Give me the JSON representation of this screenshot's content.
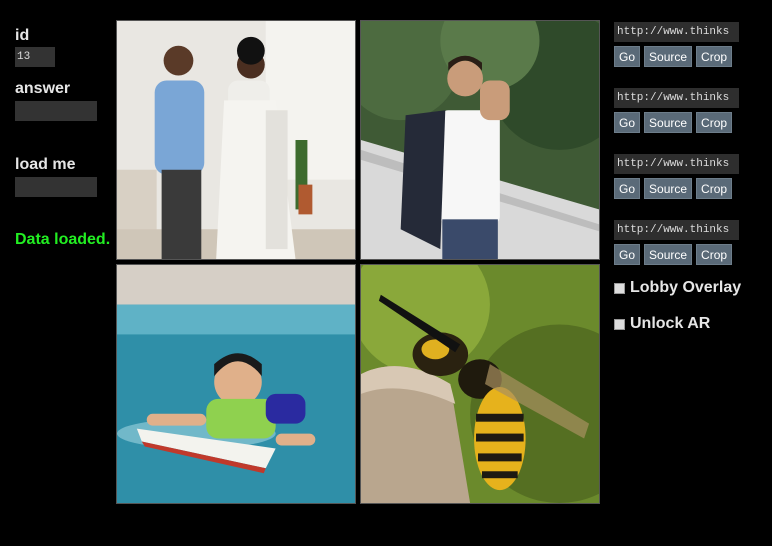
{
  "left": {
    "id_label": "id",
    "id_value": "13",
    "answer_label": "answer",
    "answer_value": "",
    "load_label": "load me",
    "load_value": "",
    "status_text": "Data loaded."
  },
  "images": [
    {
      "subject": "couple-dressing"
    },
    {
      "subject": "man-on-phone"
    },
    {
      "subject": "boy-swimming"
    },
    {
      "subject": "wasp-closeup"
    }
  ],
  "right": {
    "rows": [
      {
        "url": "http://www.thinks",
        "go": "Go",
        "source": "Source",
        "crop": "Crop"
      },
      {
        "url": "http://www.thinks",
        "go": "Go",
        "source": "Source",
        "crop": "Crop"
      },
      {
        "url": "http://www.thinks",
        "go": "Go",
        "source": "Source",
        "crop": "Crop"
      },
      {
        "url": "http://www.thinks",
        "go": "Go",
        "source": "Source",
        "crop": "Crop"
      }
    ],
    "lobby_label": "Lobby Overlay",
    "unlock_label": "Unlock AR"
  },
  "colors": {
    "background": "#000000",
    "status_green": "#22ee22",
    "button_bg": "#5a6a78"
  }
}
